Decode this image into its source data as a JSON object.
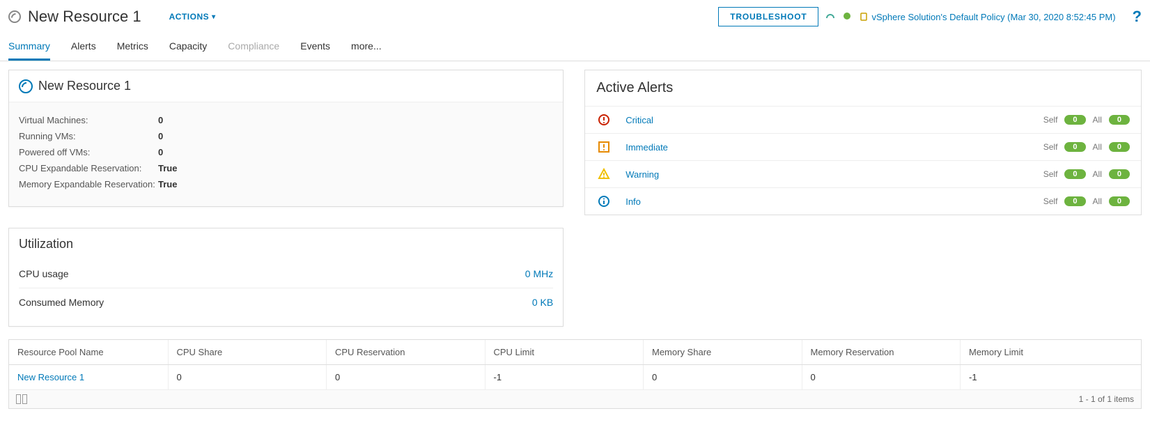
{
  "header": {
    "title": "New Resource 1",
    "actions_label": "ACTIONS",
    "troubleshoot": "TROUBLESHOOT",
    "policy_text": "vSphere Solution's Default Policy (Mar 30, 2020 8:52:45 PM)",
    "help": "?"
  },
  "tabs": [
    "Summary",
    "Alerts",
    "Metrics",
    "Capacity",
    "Compliance",
    "Events",
    "more..."
  ],
  "summary_panel": {
    "title": "New Resource 1",
    "props": [
      {
        "label": "Virtual Machines:",
        "value": "0"
      },
      {
        "label": "Running VMs:",
        "value": "0"
      },
      {
        "label": "Powered off VMs:",
        "value": "0"
      },
      {
        "label": "CPU Expandable Reservation:",
        "value": "True"
      },
      {
        "label": "Memory Expandable Reservation:",
        "value": "True"
      }
    ]
  },
  "utilization": {
    "title": "Utilization",
    "rows": [
      {
        "label": "CPU usage",
        "value": "0 MHz"
      },
      {
        "label": "Consumed Memory",
        "value": "0 KB"
      }
    ]
  },
  "alerts_panel": {
    "title": "Active Alerts",
    "self_label": "Self",
    "all_label": "All",
    "rows": [
      {
        "name": "Critical",
        "color": "#c92100",
        "self": "0",
        "all": "0"
      },
      {
        "name": "Immediate",
        "color": "#e68a00",
        "self": "0",
        "all": "0"
      },
      {
        "name": "Warning",
        "color": "#f0c000",
        "self": "0",
        "all": "0"
      },
      {
        "name": "Info",
        "color": "#0079b8",
        "self": "0",
        "all": "0"
      }
    ]
  },
  "grid": {
    "headers": [
      "Resource Pool Name",
      "CPU Share",
      "CPU Reservation",
      "CPU Limit",
      "Memory Share",
      "Memory Reservation",
      "Memory Limit"
    ],
    "row": {
      "name": "New Resource 1",
      "cpu_share": "0",
      "cpu_res": "0",
      "cpu_limit": "-1",
      "mem_share": "0",
      "mem_res": "0",
      "mem_limit": "-1"
    },
    "footer": "1 - 1 of 1 items"
  }
}
